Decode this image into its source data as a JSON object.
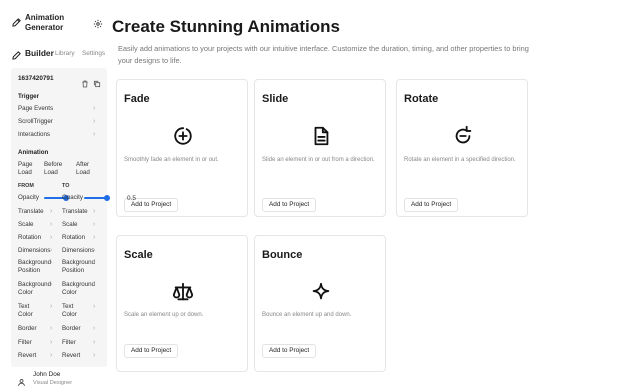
{
  "main": {
    "title": "Create Stunning Animations",
    "description": "Easily add animations to your projects with our intuitive interface. Customize the duration, timing, and other properties to bring your designs to life.",
    "cards": [
      {
        "title": "Fade",
        "icon": "plus-circle-icon",
        "desc": "Smoothly fade an element in or out.",
        "button": "Add to Project"
      },
      {
        "title": "Slide",
        "icon": "document-icon",
        "desc": "Slide an element in or out from a direction.",
        "button": "Add to Project"
      },
      {
        "title": "Rotate",
        "icon": "rotate-icon",
        "desc": "Rotate an element in a specified direction.",
        "button": "Add to Project"
      },
      {
        "title": "Scale",
        "icon": "scale-icon",
        "desc": "Scale an element up or down.",
        "button": "Add to Project"
      },
      {
        "title": "Bounce",
        "icon": "sparkle-icon",
        "desc": "Bounce an element up and down.",
        "button": "Add to Project"
      }
    ]
  },
  "sidebar": {
    "app_title_line1": "Animation",
    "app_title_line2": "Generator",
    "nav": {
      "builder": "Builder",
      "library": "Library",
      "settings": "Settings"
    },
    "panel": {
      "id": "1637420791",
      "trigger_heading": "Trigger",
      "trigger_items": [
        "Page Events",
        "ScrollTrigger",
        "Interactions"
      ],
      "animation_heading": "Animation",
      "load_options": [
        {
          "line1": "Page",
          "line2": "Load"
        },
        {
          "line1": "Before",
          "line2": "Load"
        },
        {
          "line1": "After",
          "line2": "Load"
        }
      ],
      "from_label": "FROM",
      "to_label": "TO",
      "opacity_label": "Opacity",
      "opacity_value": "0.5",
      "opacity_fraction": 0.5,
      "properties": [
        {
          "line1": "Translate",
          "line2": ""
        },
        {
          "line1": "Scale",
          "line2": ""
        },
        {
          "line1": "Rotation",
          "line2": ""
        },
        {
          "line1": "Dimensions",
          "line2": ""
        },
        {
          "line1": "Background",
          "line2": "Position"
        },
        {
          "line1": "Background",
          "line2": "Color"
        },
        {
          "line1": "Text",
          "line2": "Color"
        },
        {
          "line1": "Border",
          "line2": ""
        },
        {
          "line1": "Filter",
          "line2": ""
        },
        {
          "line1": "Revert",
          "line2": ""
        }
      ]
    },
    "user": {
      "name": "John Doe",
      "role": "Visual Designer"
    }
  },
  "colors": {
    "accent": "#1e6ee8",
    "panel_bg": "#f5f5f5",
    "muted_text": "#777777"
  }
}
